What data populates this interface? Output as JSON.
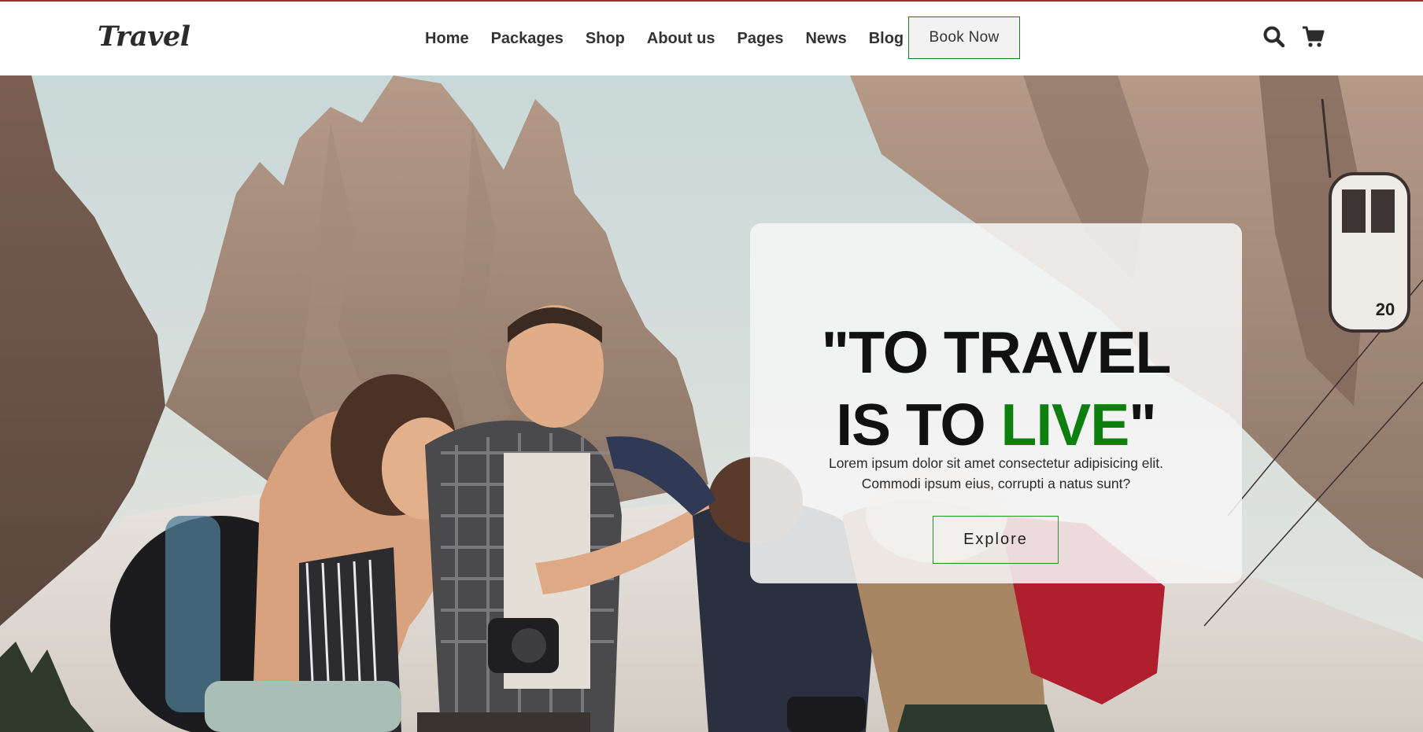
{
  "brand": {
    "logo_text": "Travel"
  },
  "nav": {
    "items": [
      "Home",
      "Packages",
      "Shop",
      "About us",
      "Pages",
      "News",
      "Blog"
    ],
    "book_button": "Book Now",
    "icons": [
      "search-icon",
      "cart-icon"
    ]
  },
  "hero": {
    "quote_part1": "\"TO TRAVEL",
    "quote_part2": "IS TO ",
    "quote_highlight": "LIVE",
    "quote_end": "\"",
    "description_line1": "Lorem ipsum dolor sit amet consectetur adipisicing elit.",
    "description_line2": "Commodi ipsum eius, corrupti a natus sunt?",
    "explore_button": "Explore",
    "cable_car_number": "20"
  },
  "colors": {
    "accent_green": "#0e7f0e",
    "top_border": "#a52a2a",
    "text_dark": "#111111"
  }
}
